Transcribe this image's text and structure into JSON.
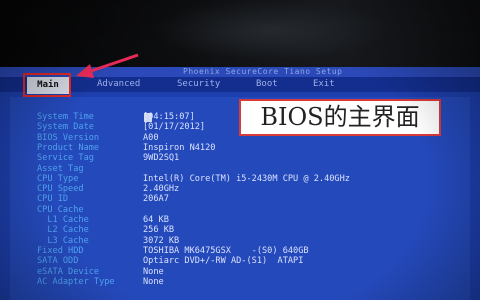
{
  "title_bar": {
    "text": "Phoenix SecureCore Tiano Setup"
  },
  "menu": [
    {
      "label": "Main",
      "selected": true
    },
    {
      "label": "Advanced"
    },
    {
      "label": "Security"
    },
    {
      "label": "Boot"
    },
    {
      "label": "Exit"
    }
  ],
  "annotation": {
    "text": "BIOS的主界面"
  },
  "system_info": [
    {
      "label": "System Time",
      "value": "[04:15:07]"
    },
    {
      "label": "System Date",
      "value": "[01/17/2012]"
    },
    {
      "label": "BIOS Version",
      "value": "A00"
    },
    {
      "label": "Product Name",
      "value": "Inspiron N4120"
    },
    {
      "label": "Service Tag",
      "value": "9WD2SQ1"
    },
    {
      "label": "Asset Tag",
      "value": ""
    },
    {
      "label": "CPU Type",
      "value": "Intel(R) Core(TM) i5-2430M CPU @ 2.40GHz"
    },
    {
      "label": "CPU Speed",
      "value": "2.40GHz"
    },
    {
      "label": "CPU ID",
      "value": "206A7"
    },
    {
      "label": "CPU Cache",
      "value": ""
    },
    {
      "label": "  L1 Cache",
      "value": "64 KB"
    },
    {
      "label": "  L2 Cache",
      "value": "256 KB"
    },
    {
      "label": "  L3 Cache",
      "value": "3072 KB"
    },
    {
      "label": "Fixed HDD",
      "value": "TOSHIBA MK6475GSX    -(S0) 640GB"
    },
    {
      "label": "SATA ODD",
      "value": "Optiarc DVD+/-RW AD-(S1)  ATAPI"
    },
    {
      "label": "eSATA Device",
      "value": "None"
    },
    {
      "label": "AC Adapter Type",
      "value": "None"
    }
  ],
  "colors": {
    "bios_background": "#2449bb",
    "label_color": "#4fa2ee",
    "value_color": "#d9e2ff",
    "highlight_red": "#e52a2a"
  }
}
